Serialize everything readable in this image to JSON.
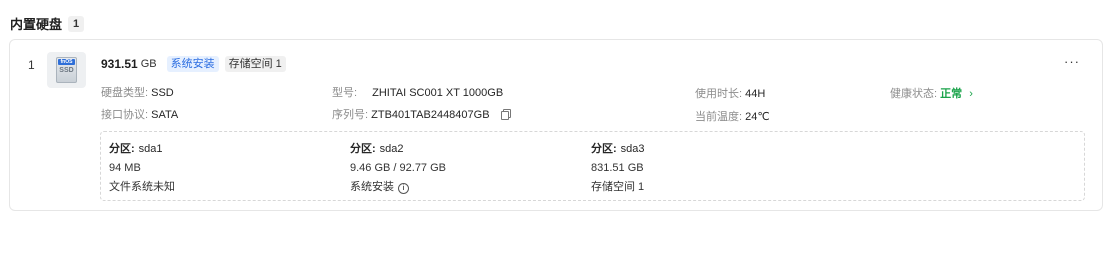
{
  "section": {
    "title": "内置硬盘",
    "count": "1"
  },
  "disk": {
    "index": "1",
    "thumb_brand": "fnOS",
    "thumb_kind": "SSD",
    "capacity": "931.51",
    "capacity_unit": "GB",
    "tags": [
      "系统安装",
      "存储空间 1"
    ],
    "more_label": "···",
    "info": {
      "type_label": "硬盘类型:",
      "type_value": "SSD",
      "iface_label": "接口协议:",
      "iface_value": "SATA",
      "model_label": "型号:",
      "model_value": "ZHITAI SC001 XT 1000GB",
      "serial_label": "序列号:",
      "serial_value": "ZTB401TAB2448407GB",
      "uptime_label": "使用时长:",
      "uptime_value": "44H",
      "temp_label": "当前温度:",
      "temp_value": "24℃",
      "health_label": "健康状态:",
      "health_value": "正常",
      "health_chevron": "›"
    },
    "partitions": [
      {
        "label": "分区:",
        "name": "sda1",
        "size": "94 MB",
        "fs": "文件系统未知"
      },
      {
        "label": "分区:",
        "name": "sda2",
        "size": "9.46 GB / 92.77 GB",
        "fs": "系统安装"
      },
      {
        "label": "分区:",
        "name": "sda3",
        "size": "831.51 GB",
        "fs": "存储空间 1"
      }
    ],
    "info_icon_glyph": "i"
  }
}
